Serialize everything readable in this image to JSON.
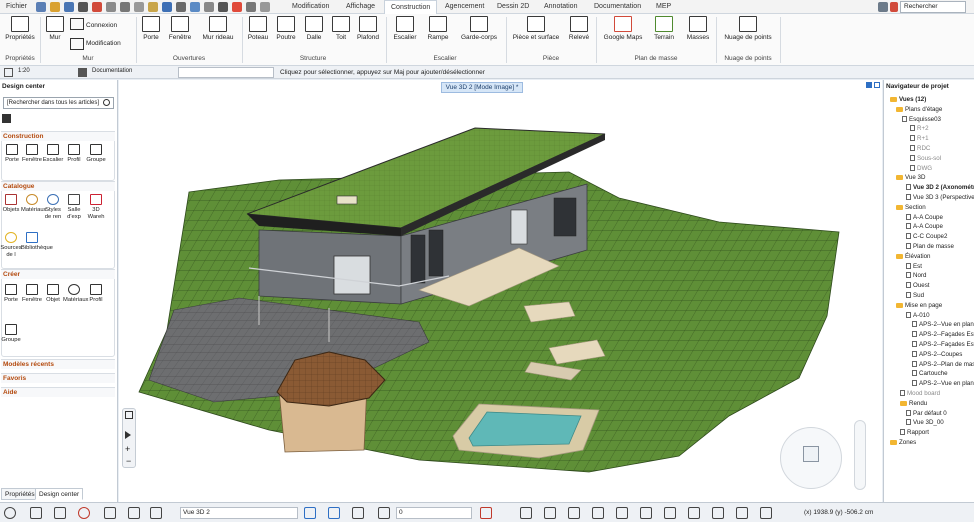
{
  "menu": {
    "file": "Fichier",
    "tabs": [
      "Modification",
      "Affichage",
      "Construction",
      "Agencement",
      "Dessin 2D",
      "Annotation",
      "Documentation",
      "MEP"
    ],
    "active_tab": "Construction",
    "search_placeholder": "Rechercher"
  },
  "ribbon": {
    "properties": {
      "label": "Propriétés",
      "group": "Propriétés"
    },
    "mur": {
      "wall": "Mur",
      "connect": "Connexion",
      "modify": "Modification",
      "group": "Mur"
    },
    "ouvertures": {
      "items": [
        "Porte",
        "Fenêtre",
        "Mur rideau"
      ],
      "group": "Ouvertures"
    },
    "structure": {
      "items": [
        "Poteau",
        "Poutre",
        "Dalle",
        "Toit",
        "Plafond"
      ],
      "group": "Structure"
    },
    "escalier": {
      "items": [
        "Escalier",
        "Rampe",
        "Garde-corps"
      ],
      "group": "Escalier"
    },
    "piece": {
      "items": [
        "Pièce et surface",
        "Relevé"
      ],
      "group": "Pièce"
    },
    "masse": {
      "items": [
        "Google Maps",
        "Terrain",
        "Masses"
      ],
      "group": "Plan de masse"
    },
    "nuage": {
      "items": [
        "Nuage de points"
      ],
      "group": "Nuage de points"
    }
  },
  "options": {
    "scale": "1:20",
    "layer": "Documentation",
    "hint": "Cliquez pour sélectionner, appuyez sur Maj pour ajouter/désélectionner"
  },
  "left_panel": {
    "title": "Design center",
    "search_placeholder": "[Rechercher dans tous les articles]",
    "construction": {
      "title": "Construction",
      "items": [
        "Porte",
        "Fenêtre",
        "Escalier",
        "Profil",
        "Groupe"
      ]
    },
    "catalogue": {
      "title": "Catalogue",
      "items": [
        "Objets",
        "Matériaux",
        "Styles de ren",
        "Salle d'exp",
        "3D Wareh",
        "Sources de l",
        "Bibliothèque"
      ]
    },
    "creer": {
      "title": "Créer",
      "items": [
        "Porte",
        "Fenêtre",
        "Objet",
        "Matériaux",
        "Profil",
        "Groupe"
      ]
    },
    "collapsed": [
      "Modèles récents",
      "Favoris",
      "Aide"
    ],
    "bottom_tabs": [
      "Propriétés",
      "Design center"
    ]
  },
  "viewport": {
    "tab_label": "Vue 3D 2 [Mode Image] *"
  },
  "navigator": {
    "title": "Navigateur de projet",
    "items": [
      {
        "label": "Vues (12)",
        "kind": "root"
      },
      {
        "label": "Plans d'étage",
        "kind": "folder"
      },
      {
        "label": "Esquisse03",
        "kind": "doc"
      },
      {
        "label": "R+2",
        "kind": "gray"
      },
      {
        "label": "R+1",
        "kind": "gray"
      },
      {
        "label": "RDC",
        "kind": "gray"
      },
      {
        "label": "Sous-sol",
        "kind": "gray"
      },
      {
        "label": "DWG",
        "kind": "gray"
      },
      {
        "label": "Vue 3D",
        "kind": "folder"
      },
      {
        "label": "Vue 3D 2 (Axonométrie)",
        "kind": "bold"
      },
      {
        "label": "Vue 3D 3 (Perspective)",
        "kind": "doc"
      },
      {
        "label": "Section",
        "kind": "folder"
      },
      {
        "label": "A-A Coupe",
        "kind": "doc"
      },
      {
        "label": "A-A Coupe",
        "kind": "doc"
      },
      {
        "label": "C-C Coupe2",
        "kind": "doc"
      },
      {
        "label": "Plan de masse",
        "kind": "doc"
      },
      {
        "label": "Élévation",
        "kind": "folder"
      },
      {
        "label": "Est",
        "kind": "doc"
      },
      {
        "label": "Nord",
        "kind": "doc"
      },
      {
        "label": "Ouest",
        "kind": "doc"
      },
      {
        "label": "Sud",
        "kind": "doc"
      },
      {
        "label": "Mise en page",
        "kind": "folder"
      },
      {
        "label": "A-010",
        "kind": "doc"
      },
      {
        "label": "APS-2--Vue en plan",
        "kind": "doc"
      },
      {
        "label": "APS-2--Façades Est",
        "kind": "doc"
      },
      {
        "label": "APS-2--Façades Est",
        "kind": "doc"
      },
      {
        "label": "APS-2--Coupes",
        "kind": "doc"
      },
      {
        "label": "APS-2--Plan de masse",
        "kind": "doc"
      },
      {
        "label": "Cartouche",
        "kind": "doc"
      },
      {
        "label": "APS-2--Vue en plan",
        "kind": "doc"
      },
      {
        "label": "Mood board",
        "kind": "gray"
      },
      {
        "label": "Rendu",
        "kind": "folder"
      },
      {
        "label": "Par défaut 0",
        "kind": "doc"
      },
      {
        "label": "Vue 3D_00",
        "kind": "doc"
      },
      {
        "label": "Rapport",
        "kind": "doc"
      },
      {
        "label": "Zones",
        "kind": "folder"
      }
    ]
  },
  "statusbar": {
    "view_select": "Vue 3D 2",
    "value_field": "0",
    "coords": "(x) 1938.9  (y) -506.2 cm"
  },
  "colors": {
    "accent_orange": "#b44a0e",
    "lawn": "#5f8f37",
    "roof_green": "#6c9b3d",
    "wall_dark": "#6f7378",
    "pool": "#5fb8b7"
  }
}
